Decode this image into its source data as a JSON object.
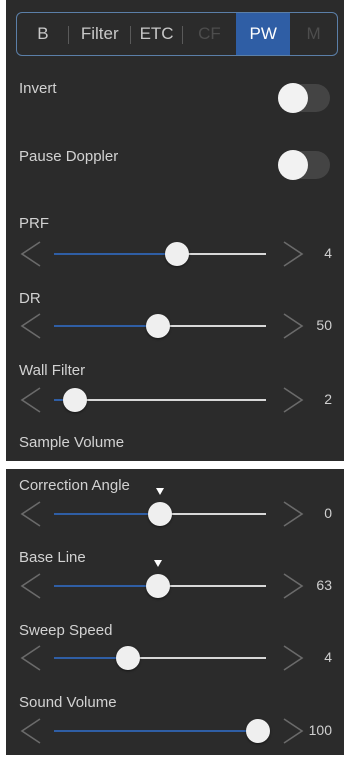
{
  "tabs": [
    {
      "label": "B",
      "state": "normal"
    },
    {
      "label": "Filter",
      "state": "normal"
    },
    {
      "label": "ETC",
      "state": "normal"
    },
    {
      "label": "CF",
      "state": "disabled"
    },
    {
      "label": "PW",
      "state": "active"
    },
    {
      "label": "M",
      "state": "disabled"
    }
  ],
  "top": {
    "invert": {
      "label": "Invert",
      "on": false
    },
    "pause_doppler": {
      "label": "Pause Doppler",
      "on": false
    },
    "prf": {
      "label": "PRF",
      "value": "4",
      "position": 0.58
    },
    "dr": {
      "label": "DR",
      "value": "50",
      "position": 0.49
    },
    "wall_filter": {
      "label": "Wall Filter",
      "value": "2",
      "position": 0.1
    },
    "sample_volume": {
      "label": "Sample Volume"
    }
  },
  "bottom": {
    "correction_angle": {
      "label": "Correction Angle",
      "value": "0",
      "position": 0.5,
      "marker": 0.5
    },
    "base_line": {
      "label": "Base Line",
      "value": "63",
      "position": 0.49,
      "marker": 0.49
    },
    "sweep_speed": {
      "label": "Sweep Speed",
      "value": "4",
      "position": 0.35
    },
    "sound_volume": {
      "label": "Sound Volume",
      "value": "100",
      "position": 0.96
    }
  },
  "colors": {
    "accent": "#2f5ea5",
    "panel": "#2b2b2b",
    "border": "#5b7fa8"
  },
  "icons": {
    "left": "chevron-left-icon",
    "right": "chevron-right-icon"
  }
}
